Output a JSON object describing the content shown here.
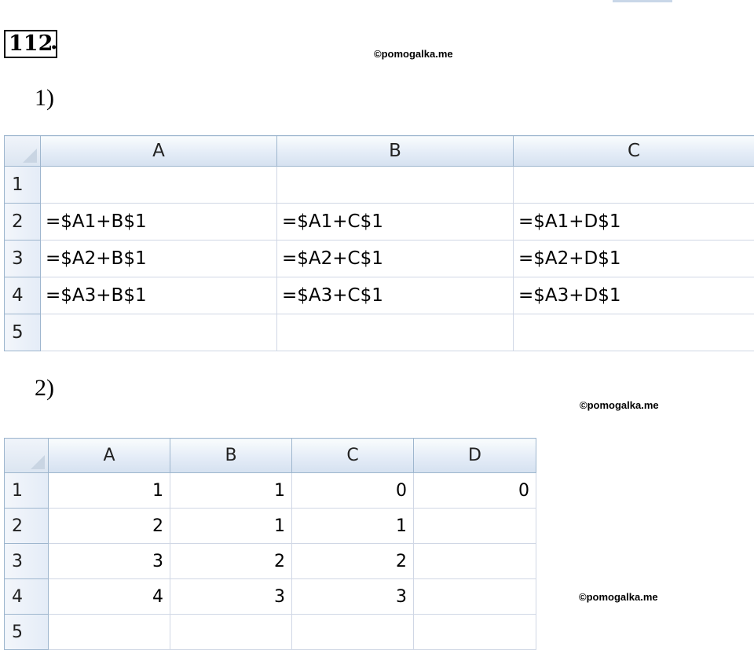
{
  "problem": {
    "number": "112",
    "dot": "."
  },
  "watermarks": [
    "©pomogalka.me",
    "©pomogalka.me",
    "©pomogalka.me"
  ],
  "part1": {
    "label": "1)",
    "sheet": {
      "corner": "",
      "columns": [
        "A",
        "B",
        "C"
      ],
      "rows": [
        {
          "head": "1",
          "cells": [
            "",
            "",
            ""
          ]
        },
        {
          "head": "2",
          "cells": [
            "=$A1+B$1",
            "=$A1+C$1",
            "=$A1+D$1"
          ]
        },
        {
          "head": "3",
          "cells": [
            "=$A2+B$1",
            "=$A2+C$1",
            "=$A2+D$1"
          ]
        },
        {
          "head": "4",
          "cells": [
            "=$A3+B$1",
            "=$A3+C$1",
            "=$A3+D$1"
          ]
        },
        {
          "head": "5",
          "cells": [
            "",
            "",
            ""
          ]
        }
      ]
    }
  },
  "part2": {
    "label": "2)",
    "sheet": {
      "columns": [
        "A",
        "B",
        "C",
        "D"
      ],
      "rows": [
        {
          "head": "1",
          "cells": [
            "1",
            "1",
            "0",
            "0"
          ]
        },
        {
          "head": "2",
          "cells": [
            "2",
            "1",
            "1",
            ""
          ]
        },
        {
          "head": "3",
          "cells": [
            "3",
            "2",
            "2",
            ""
          ]
        },
        {
          "head": "4",
          "cells": [
            "4",
            "3",
            "3",
            ""
          ]
        },
        {
          "head": "5",
          "cells": [
            "",
            "",
            "",
            ""
          ]
        }
      ]
    }
  }
}
